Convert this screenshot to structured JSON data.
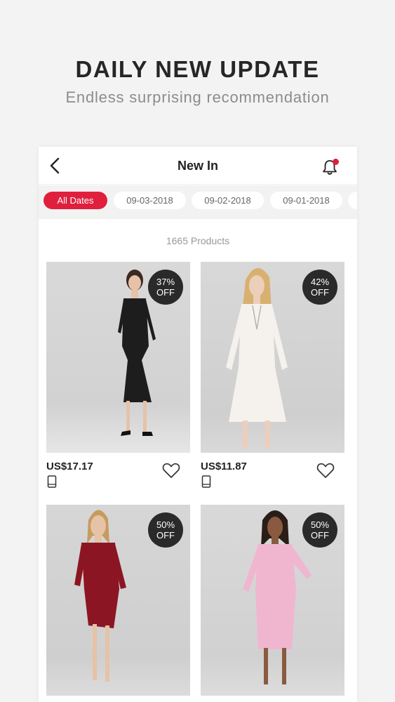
{
  "promo": {
    "title": "DAILY NEW UPDATE",
    "subtitle": "Endless surprising recommendation"
  },
  "nav": {
    "title": "New In",
    "back_icon": "chevron-left-icon",
    "bell_icon": "bell-icon",
    "notification_dot_color": "#e01f3d"
  },
  "filters": [
    {
      "label": "All Dates",
      "active": true
    },
    {
      "label": "09-03-2018",
      "active": false
    },
    {
      "label": "09-02-2018",
      "active": false
    },
    {
      "label": "09-01-2018",
      "active": false
    }
  ],
  "accent_color": "#e01f3d",
  "product_count": "1665 Products",
  "products": [
    {
      "price": "US$17.17",
      "discount": "37%",
      "off": "OFF",
      "dress_color": "#1d1d1d"
    },
    {
      "price": "US$11.87",
      "discount": "42%",
      "off": "OFF",
      "dress_color": "#f5f2ed"
    },
    {
      "price": "",
      "discount": "50%",
      "off": "OFF",
      "dress_color": "#8c1524"
    },
    {
      "price": "",
      "discount": "50%",
      "off": "OFF",
      "dress_color": "#f0b6cf"
    }
  ]
}
